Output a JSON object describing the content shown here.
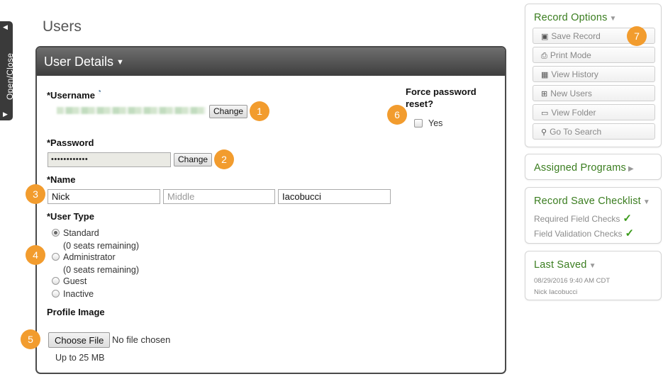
{
  "sidebar_tab": {
    "label": "Open/Close"
  },
  "page": {
    "title": "Users"
  },
  "panel": {
    "title": "User Details"
  },
  "username": {
    "label": "*Username",
    "change_label": "Change",
    "badge": "1"
  },
  "password": {
    "label": "*Password",
    "masked": "••••••••••••",
    "change_label": "Change",
    "badge": "2"
  },
  "name": {
    "label": "*Name",
    "badge": "3",
    "first": "Nick",
    "middle_placeholder": "Middle",
    "last": "Iacobucci"
  },
  "user_type": {
    "label": "*User Type",
    "badge": "4",
    "options": [
      {
        "label": "Standard",
        "sub": "(0 seats remaining)",
        "checked": true
      },
      {
        "label": "Administrator",
        "sub": "(0 seats remaining)",
        "checked": false
      },
      {
        "label": "Guest",
        "checked": false
      },
      {
        "label": "Inactive",
        "checked": false
      }
    ]
  },
  "profile_image": {
    "label": "Profile Image",
    "badge": "5",
    "choose_label": "Choose File",
    "status": "No file chosen",
    "limit": "Up to 25 MB"
  },
  "force_reset": {
    "label_line1": "Force password",
    "label_line2": "reset?",
    "option": "Yes",
    "badge": "6"
  },
  "record_options": {
    "title": "Record Options",
    "badge": "7",
    "buttons": [
      {
        "label": "Save Record",
        "icon": "save-icon"
      },
      {
        "label": "Print Mode",
        "icon": "print-icon"
      },
      {
        "label": "View History",
        "icon": "calendar-icon"
      },
      {
        "label": "New Users",
        "icon": "new-doc-icon"
      },
      {
        "label": "View Folder",
        "icon": "folder-icon"
      },
      {
        "label": "Go To Search",
        "icon": "search-icon"
      }
    ]
  },
  "assigned_programs": {
    "title": "Assigned Programs"
  },
  "save_checklist": {
    "title": "Record Save Checklist",
    "items": [
      "Required Field Checks",
      "Field Validation Checks"
    ]
  },
  "last_saved": {
    "title": "Last Saved",
    "date": "08/29/2016 9:40 AM CDT",
    "user": "Nick Iacobucci"
  },
  "colors": {
    "accent_green": "#3a7d1f",
    "badge_orange": "#f29c2e",
    "header_dark": "#4a4a4a"
  }
}
